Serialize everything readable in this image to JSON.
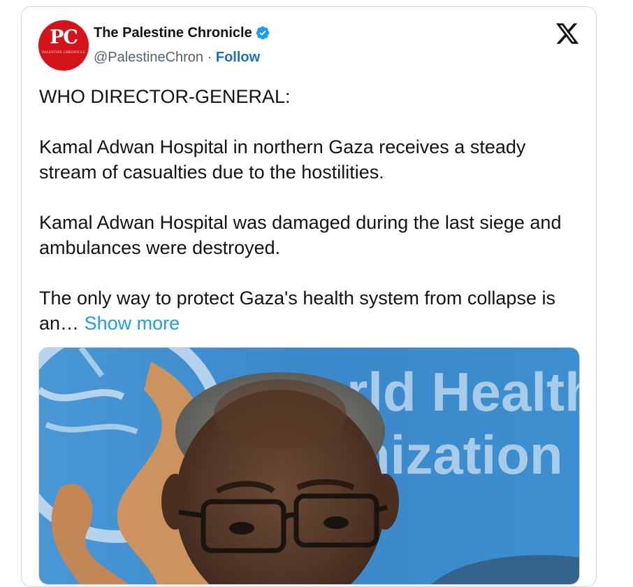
{
  "tweet": {
    "avatar_text": "PC",
    "avatar_subtext": "PALESTINE CHRONICLE",
    "display_name": "The Palestine Chronicle",
    "handle": "@PalestineChron",
    "separator": "·",
    "follow_label": "Follow",
    "paragraphs": [
      "WHO DIRECTOR-GENERAL:",
      "Kamal Adwan Hospital in northern Gaza receives a steady stream of casualties due to the hostilities.",
      "Kamal Adwan Hospital was damaged during the last siege and ambulances were destroyed.",
      "The only way to protect Gaza's health system from collapse is an…"
    ],
    "show_more_label": "Show more",
    "media": {
      "description_icon": "photo-of-who-director-general",
      "sign_text_line1": "rld Health",
      "sign_text_line2": "nization"
    }
  },
  "colors": {
    "accent": "#1d9bf0",
    "follow": "#1d6fb8",
    "verified": "#1d9bf0",
    "brand_red": "#d4141b",
    "who_blue": "#3d8fcf"
  }
}
